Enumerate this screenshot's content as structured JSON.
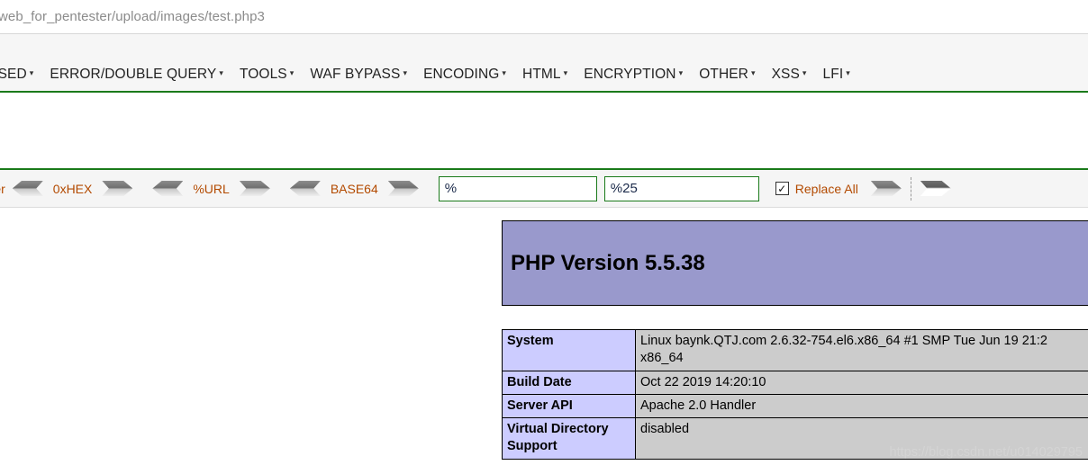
{
  "browser": {
    "url": "web_for_pentester/upload/images/test.php3"
  },
  "nav": {
    "items": [
      {
        "label": "N BASED",
        "has_caret": true
      },
      {
        "label": "ERROR/DOUBLE QUERY",
        "has_caret": true
      },
      {
        "label": "TOOLS",
        "has_caret": true
      },
      {
        "label": "WAF BYPASS",
        "has_caret": true
      },
      {
        "label": "ENCODING",
        "has_caret": true
      },
      {
        "label": "HTML",
        "has_caret": true
      },
      {
        "label": "ENCRYPTION",
        "has_caret": true
      },
      {
        "label": "OTHER",
        "has_caret": true
      },
      {
        "label": "XSS",
        "has_caret": true
      },
      {
        "label": "LFI",
        "has_caret": true
      }
    ],
    "caret_glyph": "▾",
    "accent_color": "#1a7a1a"
  },
  "toolbar": {
    "clipped_label": "rrer",
    "encoders": [
      {
        "label": "0xHEX"
      },
      {
        "label": "%URL"
      },
      {
        "label": "BASE64"
      }
    ],
    "search_value": "%",
    "search_placeholder": "",
    "replace_value": "%25",
    "replace_placeholder": "",
    "replace_all_label": "Replace All",
    "replace_all_checked": true,
    "check_glyph": "✓",
    "label_color": "#b34a00",
    "field_border_color": "#1a7a1a"
  },
  "phpinfo": {
    "title": "PHP Version 5.5.38",
    "banner_color": "#9999cc",
    "key_color": "#ccccff",
    "value_color": "#cccccc",
    "rows": [
      {
        "key": "System",
        "value": "Linux baynk.QTJ.com 2.6.32-754.el6.x86_64 #1 SMP Tue Jun 19 21:2\nx86_64"
      },
      {
        "key": "Build Date",
        "value": "Oct 22 2019 14:20:10"
      },
      {
        "key": "Server API",
        "value": "Apache 2.0 Handler"
      },
      {
        "key": "Virtual Directory Support",
        "value": "disabled"
      }
    ]
  },
  "watermark": {
    "text": "https://blog.csdn.net/u014029795"
  }
}
